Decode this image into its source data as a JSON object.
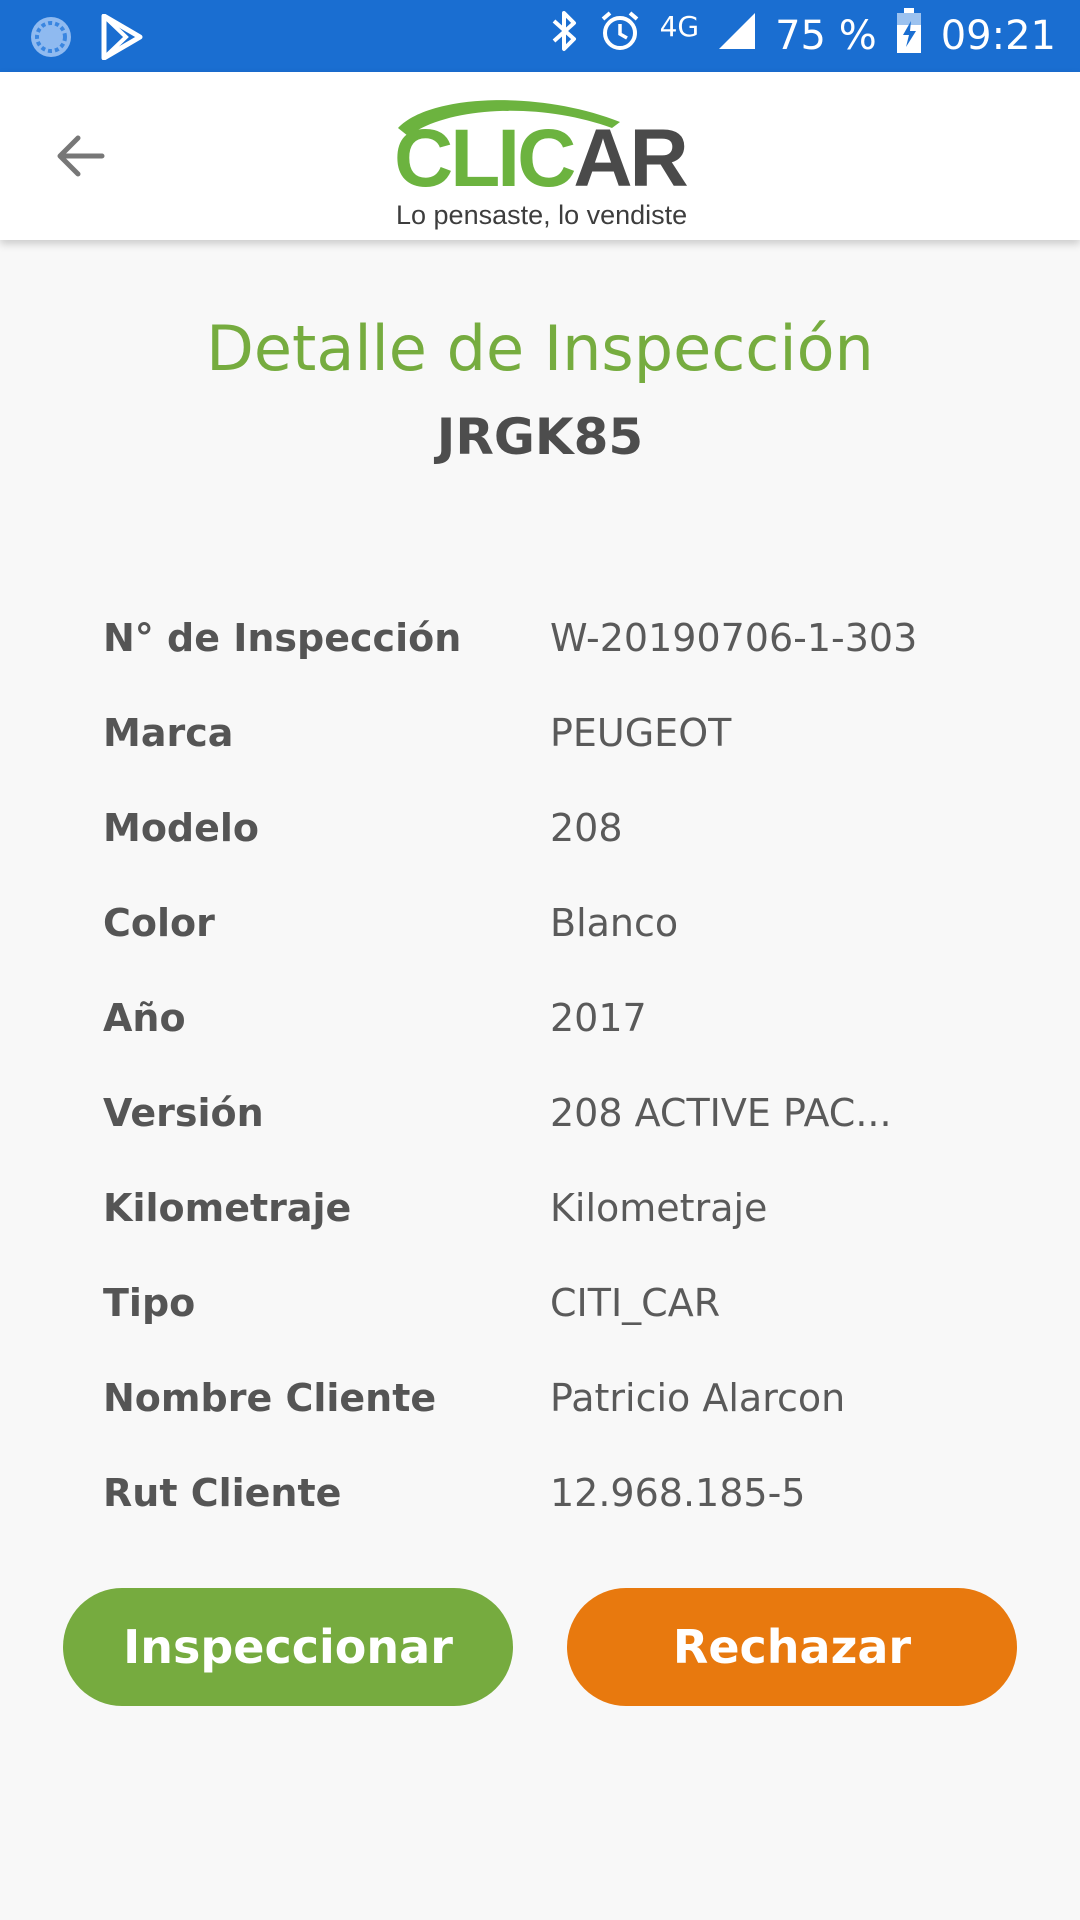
{
  "status_bar": {
    "battery": "75 %",
    "time": "09:21",
    "network": "4G",
    "bg_color": "#1a6ed1"
  },
  "app_bar": {
    "logo_text_green": "CLIC",
    "logo_text_dark": "AR",
    "logo_tagline": "Lo pensaste, lo vendiste",
    "back_icon": "arrow-left-icon"
  },
  "page": {
    "title": "Detalle de Inspección",
    "plate": "JRGK85",
    "title_color": "#76ac3f"
  },
  "details": [
    {
      "label": "N° de Inspección",
      "value": "W-20190706-1-303"
    },
    {
      "label": "Marca",
      "value": "PEUGEOT"
    },
    {
      "label": "Modelo",
      "value": "208"
    },
    {
      "label": "Color",
      "value": "Blanco"
    },
    {
      "label": "Año",
      "value": "2017"
    },
    {
      "label": "Versión",
      "value": "208 ACTIVE PAC..."
    },
    {
      "label": "Kilometraje",
      "value": "Kilometraje"
    },
    {
      "label": "Tipo",
      "value": "CITI_CAR"
    },
    {
      "label": "Nombre Cliente",
      "value": "Patricio Alarcon"
    },
    {
      "label": "Rut Cliente",
      "value": "12.968.185-5"
    }
  ],
  "actions": {
    "inspect_label": "Inspeccionar",
    "reject_label": "Rechazar",
    "inspect_color": "#76ab3f",
    "reject_color": "#e8790e"
  }
}
